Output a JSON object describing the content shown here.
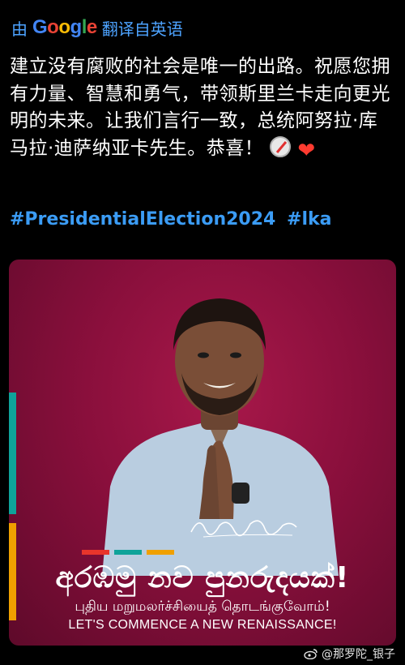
{
  "translate_bar": {
    "prefix": "由",
    "google": "Google",
    "suffix": "翻译自英语"
  },
  "post": {
    "text": "建立没有腐败的社会是唯一的出路。祝愿您拥有力量、智慧和勇气，带领斯里兰卡走向更光明的未来。让我们言行一致，总统阿努拉·库马拉·迪萨纳亚卡先生。恭喜！",
    "emojis": [
      "compass-emoji",
      "heart-on-fire-emoji"
    ],
    "hashtags": [
      "#PresidentialElection2024",
      "#lka"
    ]
  },
  "poster": {
    "headline_sinhala": "අරඹමු නව පුනරුදයක්!",
    "headline_tamil": "புதிய மறுமலர்ச்சியைத் தொடங்குவோம்!",
    "headline_english": "LET'S COMMENCE A NEW RENAISSANCE!",
    "colors": {
      "background": "#8a0f3c",
      "stripe_teal": "#0fa39a",
      "stripe_orange": "#f0a000",
      "bar_red": "#e8352b",
      "bar_teal": "#0fa39a",
      "bar_orange": "#f0a000"
    }
  },
  "watermark": {
    "text": "@那罗陀_银子"
  }
}
